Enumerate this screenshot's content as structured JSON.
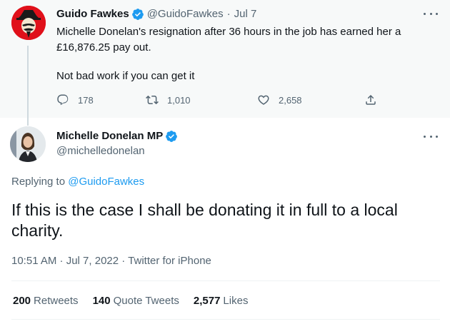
{
  "parent_tweet": {
    "name": "Guido Fawkes",
    "handle": "@GuidoFawkes",
    "separator": "·",
    "date": "Jul 7",
    "text_line1": "Michelle Donelan's resignation after 36 hours in the job has earned her a",
    "text_line2": "£16,876.25 pay out.",
    "text_line3": "Not bad work if you can get it",
    "replies": "178",
    "retweets": "1,010",
    "likes": "2,658",
    "icons": [
      "reply-icon",
      "retweet-icon",
      "like-icon",
      "share-icon",
      "more-icon",
      "verified-icon"
    ]
  },
  "main_tweet": {
    "name": "Michelle Donelan MP",
    "handle": "@michelledonelan",
    "replying_prefix": "Replying to",
    "replying_to": "@GuidoFawkes",
    "text_line1": "If this is the case I shall be donating it in full to a local",
    "text_line2": "charity.",
    "timestamp": "10:51 AM · Jul 7, 2022 · Twitter for iPhone",
    "stats": {
      "retweets_count": "200",
      "retweets_label": "Retweets",
      "quotes_count": "140",
      "quotes_label": "Quote Tweets",
      "likes_count": "2,577",
      "likes_label": "Likes"
    }
  },
  "colors": {
    "accent": "#1d9bf0",
    "text": "#0f1419",
    "muted": "#536471",
    "parent_bg": "#f7f9f9",
    "avatar_red": "#e0101a"
  }
}
